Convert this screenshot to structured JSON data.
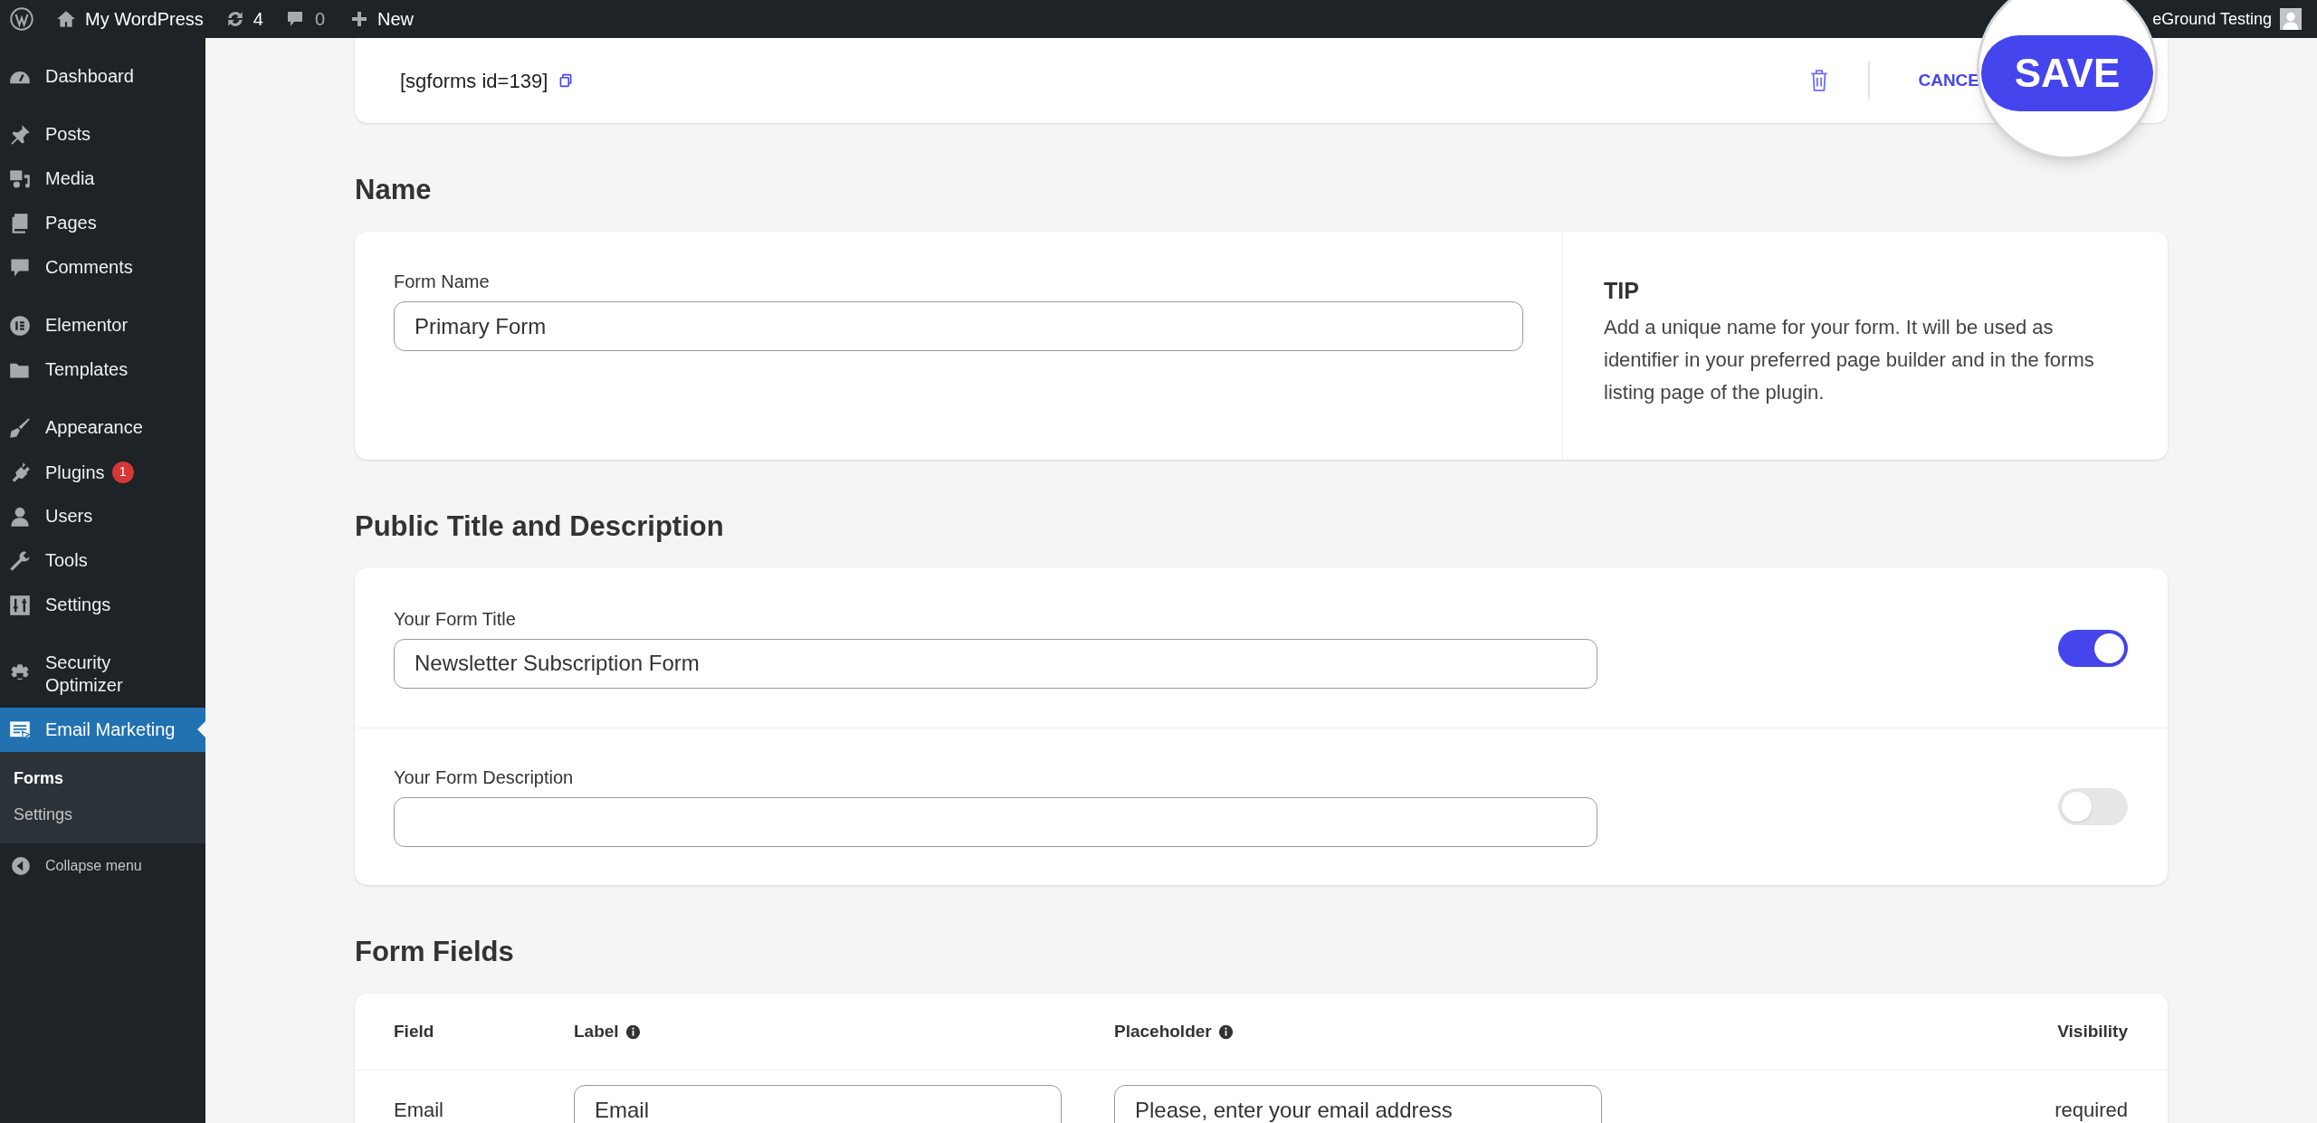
{
  "admin_bar": {
    "site_name": "My WordPress",
    "updates": "4",
    "comments": "0",
    "new": "New",
    "user": "eGround Testing"
  },
  "sidebar": {
    "groups": [
      [
        {
          "label": "Dashboard",
          "selected": false
        }
      ],
      [
        {
          "label": "Posts",
          "selected": false
        },
        {
          "label": "Media",
          "selected": false
        },
        {
          "label": "Pages",
          "selected": false
        },
        {
          "label": "Comments",
          "selected": false
        }
      ],
      [
        {
          "label": "Elementor",
          "selected": false
        },
        {
          "label": "Templates",
          "selected": false
        }
      ],
      [
        {
          "label": "Appearance",
          "selected": false
        },
        {
          "label": "Plugins",
          "selected": false,
          "badge": "1"
        },
        {
          "label": "Users",
          "selected": false
        },
        {
          "label": "Tools",
          "selected": false
        },
        {
          "label": "Settings",
          "selected": false
        }
      ],
      [
        {
          "label": "Security Optimizer",
          "selected": false
        },
        {
          "label": "Email Marketing",
          "selected": true,
          "children": [
            {
              "label": "Forms",
              "selected": true
            },
            {
              "label": "Settings",
              "selected": false
            }
          ]
        }
      ]
    ],
    "collapse": "Collapse menu"
  },
  "header": {
    "shortcode": "[sgforms id=139]",
    "cancel": "CANCE",
    "save": "SAVE"
  },
  "name_section": {
    "heading": "Name",
    "field_label": "Form Name",
    "value": "Primary Form",
    "tip_title": "TIP",
    "tip_text": "Add a unique name for your form. It will be used as identifier in your preferred page builder and in the forms listing page of the plugin."
  },
  "public_section": {
    "heading": "Public Title and Description",
    "rows": [
      {
        "label": "Your Form Title",
        "value": "Newsletter Subscription Form",
        "on": true
      },
      {
        "label": "Your Form Description",
        "on": false
      }
    ]
  },
  "form_fields": {
    "heading": "Form Fields",
    "columns": [
      {
        "label": "Field",
        "info": false
      },
      {
        "label": "Label",
        "info": true
      },
      {
        "label": "Placeholder",
        "info": true
      },
      {
        "label": "Visibility",
        "info": false
      }
    ],
    "rows": [
      {
        "field": "Email",
        "inputs": [
          {
            "value": "Email"
          },
          {
            "value": "Please, enter your email address"
          }
        ],
        "visibility": "required"
      }
    ]
  }
}
